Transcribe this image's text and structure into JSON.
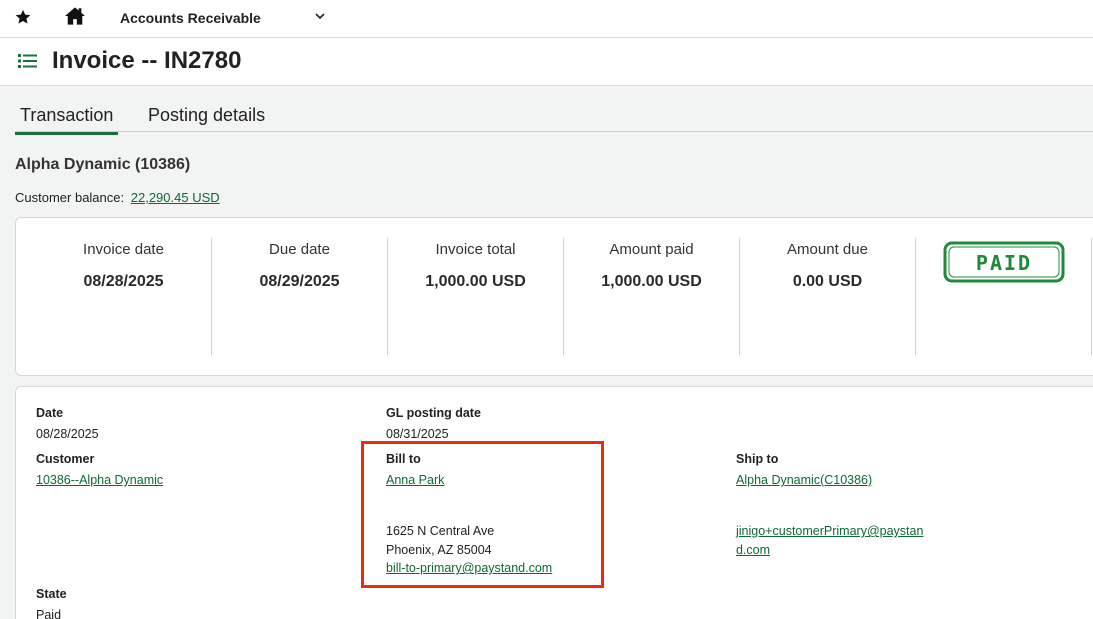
{
  "topbar": {
    "favorite_icon": "star-icon",
    "home_icon": "home-icon",
    "module_label": "Accounts Receivable",
    "dropdown_icon": "chevron-down-icon"
  },
  "header": {
    "menu_icon": "list-icon",
    "title": "Invoice -- IN2780"
  },
  "tabs": [
    {
      "label": "Transaction",
      "active": true
    },
    {
      "label": "Posting details",
      "active": false
    }
  ],
  "customer": {
    "name": "Alpha Dynamic (10386)",
    "balance_label": "Customer balance:",
    "balance_value": "22,290.45 USD"
  },
  "summary": [
    {
      "label": "Invoice date",
      "value": "08/28/2025"
    },
    {
      "label": "Due date",
      "value": "08/29/2025"
    },
    {
      "label": "Invoice total",
      "value": "1,000.00 USD"
    },
    {
      "label": "Amount paid",
      "value": "1,000.00 USD"
    },
    {
      "label": "Amount due",
      "value": "0.00 USD"
    }
  ],
  "status_stamp": "PAID",
  "details": {
    "date_label": "Date",
    "date_value": "08/28/2025",
    "gl_label": "GL posting date",
    "gl_value": "08/31/2025",
    "customer_label": "Customer",
    "customer_value": "10386--Alpha Dynamic",
    "bill_to_label": "Bill to",
    "bill_to_name": "Anna Park",
    "bill_to_street": "1625 N Central Ave",
    "bill_to_city": "Phoenix, AZ 85004",
    "bill_to_email": "bill-to-primary@paystand.com",
    "ship_to_label": "Ship to",
    "ship_to_name": "Alpha Dynamic(C10386)",
    "ship_to_email_line1": "jinigo+customerPrimary@paystan",
    "ship_to_email_line2": "d.com",
    "state_label": "State",
    "state_value": "Paid"
  },
  "colors": {
    "accent": "#17733a",
    "link": "#0c6a33",
    "stamp": "#1f8a3a",
    "highlight": "#ee2a12"
  }
}
